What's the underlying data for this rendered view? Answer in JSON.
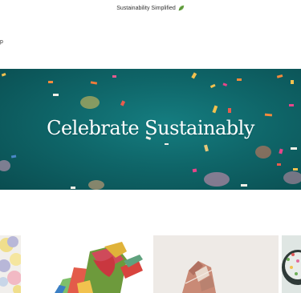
{
  "announcement": {
    "text": "Sustainability Simplified",
    "icon": "leaf-icon",
    "icon_color": "#6fa84a"
  },
  "nav": {
    "partial_label": "p"
  },
  "hero": {
    "title": "Celebrate Sustainably",
    "background": "#0f6669"
  },
  "cards": [
    {
      "name": "balloons-party"
    },
    {
      "name": "fabric-gift-wrap"
    },
    {
      "name": "wrapped-gift-box"
    },
    {
      "name": "party-food-bowl"
    }
  ]
}
